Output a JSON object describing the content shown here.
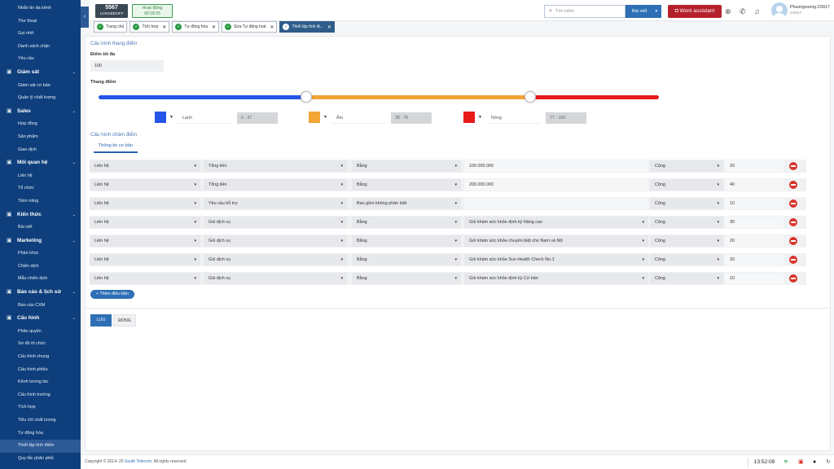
{
  "sidebar": {
    "items": [
      {
        "type": "item",
        "label": "Nhắn tin đa kênh"
      },
      {
        "type": "item",
        "label": "Thư thoại"
      },
      {
        "type": "item",
        "label": "Gọi nhỡ"
      },
      {
        "type": "item",
        "label": "Danh sách chặn"
      },
      {
        "type": "item",
        "label": "Yêu cầu"
      },
      {
        "type": "group",
        "label": "Giám sát",
        "icon": "monitor-icon"
      },
      {
        "type": "item",
        "label": "Giám sát cơ bản"
      },
      {
        "type": "item",
        "label": "Quản lý chất lượng"
      },
      {
        "type": "group",
        "label": "Sales",
        "icon": "sales-icon"
      },
      {
        "type": "item",
        "label": "Hợp đồng"
      },
      {
        "type": "item",
        "label": "Sản phẩm"
      },
      {
        "type": "item",
        "label": "Giao dịch"
      },
      {
        "type": "group",
        "label": "Mối quan hệ",
        "icon": "contacts-icon"
      },
      {
        "type": "item",
        "label": "Liên hệ"
      },
      {
        "type": "item",
        "label": "Tổ chức"
      },
      {
        "type": "item",
        "label": "Tiềm năng"
      },
      {
        "type": "group",
        "label": "Kiến thức",
        "icon": "book-icon"
      },
      {
        "type": "item",
        "label": "Bài viết"
      },
      {
        "type": "group",
        "label": "Marketing",
        "icon": "marketing-icon"
      },
      {
        "type": "item",
        "label": "Phân khúc"
      },
      {
        "type": "item",
        "label": "Chiến dịch"
      },
      {
        "type": "item",
        "label": "Mẫu chiến dịch"
      },
      {
        "type": "group",
        "label": "Báo cáo & lịch sử",
        "icon": "report-icon"
      },
      {
        "type": "item",
        "label": "Báo cáo CXM"
      },
      {
        "type": "group",
        "label": "Cấu hình",
        "icon": "settings-icon"
      },
      {
        "type": "item",
        "label": "Phân quyền"
      },
      {
        "type": "item",
        "label": "Sơ đồ tổ chức"
      },
      {
        "type": "item",
        "label": "Cấu hình chung"
      },
      {
        "type": "item",
        "label": "Cấu hình phiếu"
      },
      {
        "type": "item",
        "label": "Kênh tương tác"
      },
      {
        "type": "item",
        "label": "Cấu hình trường"
      },
      {
        "type": "item",
        "label": "Tích hợp"
      },
      {
        "type": "item",
        "label": "Tiêu chí chất lượng"
      },
      {
        "type": "item",
        "label": "Tự động hóa"
      },
      {
        "type": "item",
        "label": "Thiết lập tính điểm",
        "active": true
      },
      {
        "type": "item",
        "label": "Quy tắc phân phối"
      }
    ]
  },
  "topbar": {
    "extension": "5567",
    "extension_status": "LOGGEDOFF",
    "activity_label": "Hoạt động",
    "activity_time": "00:18:25",
    "search_placeholder": "Tìm kiếm",
    "search_type": "Bài viết",
    "woni_label": "Woni assistant",
    "user_name": "Phuongvuong.C0017",
    "user_id": "C0017"
  },
  "tabs": [
    {
      "label": "Trang chủ",
      "closable": false
    },
    {
      "label": "Tích hợp",
      "closable": true
    },
    {
      "label": "Tự động hóa",
      "closable": true
    },
    {
      "label": "Sửa Tự động hoá",
      "closable": true
    },
    {
      "label": "Thiết lập tính đi...",
      "closable": true,
      "active": true
    }
  ],
  "score_config": {
    "title": "Cấu hình thang điểm",
    "max_label": "Điểm tối đa",
    "max_value": "100",
    "scale_label": "Thang điểm",
    "slider_handles": [
      37,
      77
    ],
    "levels": [
      {
        "color": "#2555e8",
        "name": "Lạnh",
        "range": "0 - 37"
      },
      {
        "color": "#f2a435",
        "name": "Ấm",
        "range": "38 - 76"
      },
      {
        "color": "#e81a1a",
        "name": "Nóng",
        "range": "77 - 100"
      }
    ]
  },
  "rule_config": {
    "title": "Cấu hình chấm điểm",
    "tab_label": "Thông tin cơ bản",
    "rows": [
      [
        "Liên hệ",
        "Tổng tiền",
        "Bằng",
        "100.000.000",
        "Cộng",
        "20"
      ],
      [
        "Liên hệ",
        "Tổng tiền",
        "Bằng",
        "200.000.000",
        "Cộng",
        "40"
      ],
      [
        "Liên hệ",
        "Yêu cầu hỗ trợ",
        "Bao gồm không phân biệt",
        "",
        "Cộng",
        "10"
      ],
      [
        "Liên hệ",
        "Gói dịch vụ",
        "Bằng",
        "Gói khám sức khỏe định kỳ Nâng cao",
        "Cộng",
        "30"
      ],
      [
        "Liên hệ",
        "Gói dịch vụ",
        "Bằng",
        "Gói khám sức khỏe chuyên biệt cho Nam và Nữ",
        "Cộng",
        "20"
      ],
      [
        "Liên hệ",
        "Gói dịch vụ",
        "Bằng",
        "Gói khám sức khỏe Sun Health Check No.1",
        "Cộng",
        "20"
      ],
      [
        "Liên hệ",
        "Gói dịch vụ",
        "Bằng",
        "Gói khám sức khỏe định kỳ Cơ bản",
        "Cộng",
        "10"
      ]
    ],
    "add_label": "+ Thêm điều kiện"
  },
  "actions": {
    "save": "LƯU",
    "close": "ĐÓNG"
  },
  "footer": {
    "copyright_prefix": "Copyright © 2014- 25 ",
    "company": "South Telecom",
    "copyright_suffix": ". All rights reserved.",
    "clock": "13:52:09"
  }
}
